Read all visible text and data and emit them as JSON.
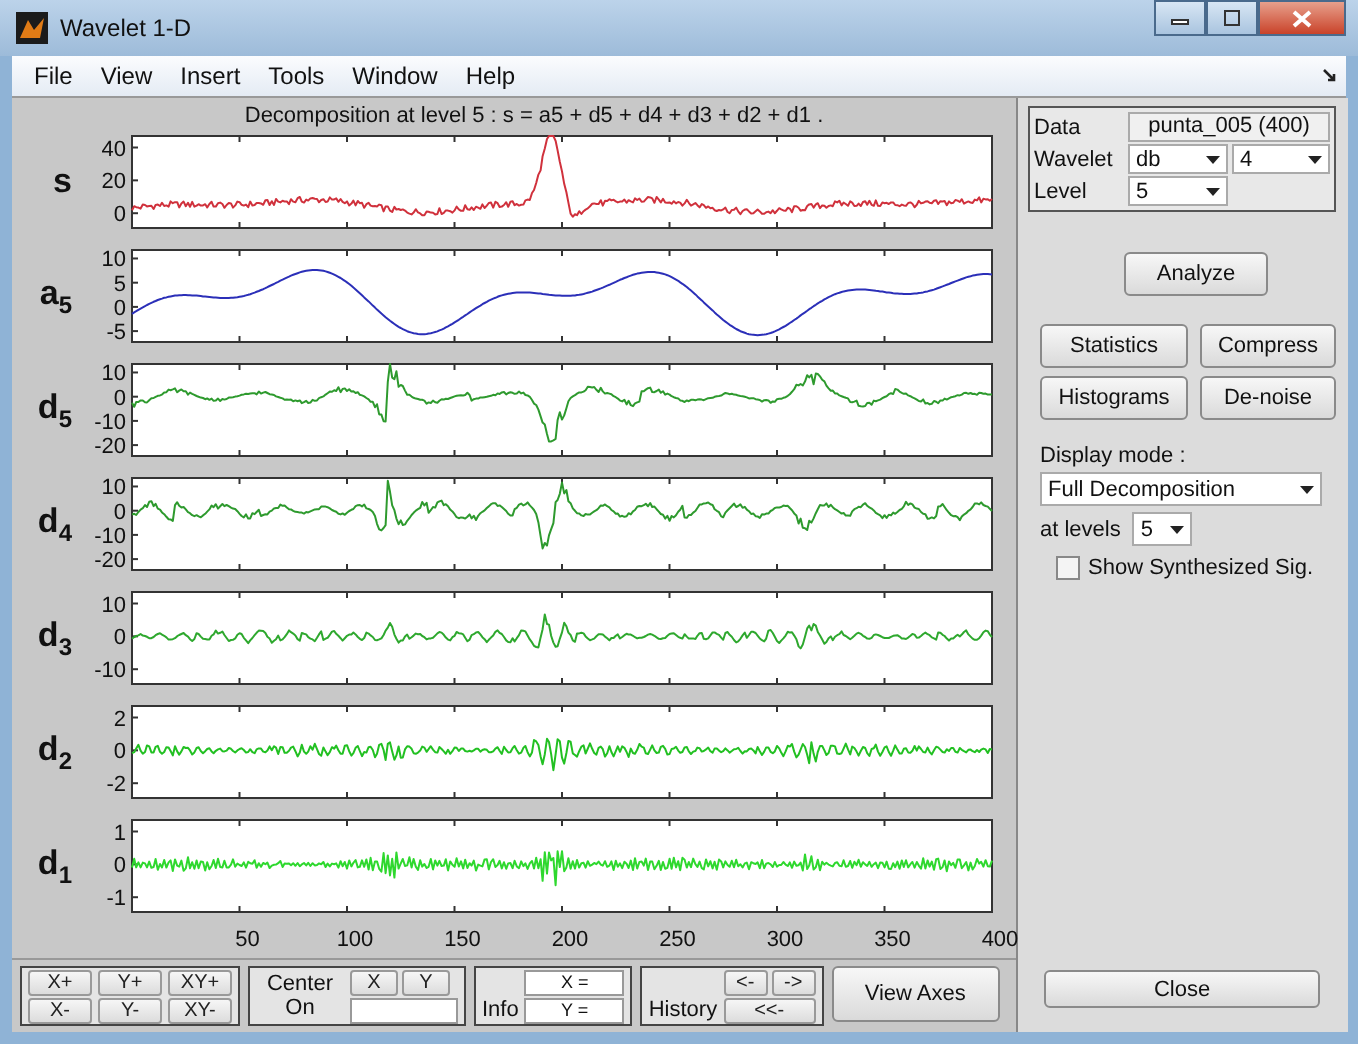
{
  "window": {
    "title": "Wavelet 1-D"
  },
  "menu": [
    "File",
    "View",
    "Insert",
    "Tools",
    "Window",
    "Help"
  ],
  "plot_title": "Decomposition at level 5 : s = a5 + d5 + d4 + d3 + d2 + d1 .",
  "plots": [
    {
      "label": "s",
      "kind": "signal",
      "color": "#d0313c",
      "yticks": [
        "40",
        "20",
        "0"
      ]
    },
    {
      "label": "a$_{5}$",
      "kind": "approximation",
      "color": "#2b2fb8",
      "yticks": [
        "10",
        "5",
        "0",
        "-5"
      ]
    },
    {
      "label": "d$_{5}$",
      "kind": "detail",
      "color": "#2e9a2e",
      "yticks": [
        "10",
        "0",
        "-10",
        "-20"
      ]
    },
    {
      "label": "d$_{4}$",
      "kind": "detail",
      "color": "#2e9a2e",
      "yticks": [
        "10",
        "0",
        "-10",
        "-20"
      ]
    },
    {
      "label": "d$_{3}$",
      "kind": "detail",
      "color": "#2ea82e",
      "yticks": [
        "10",
        "0",
        "-10"
      ]
    },
    {
      "label": "d$_{2}$",
      "kind": "detail",
      "color": "#22c022",
      "yticks": [
        "2",
        "0",
        "-2"
      ]
    },
    {
      "label": "d$_{1}$",
      "kind": "detail",
      "color": "#2ed82e",
      "yticks": [
        "1",
        "0",
        "-1"
      ]
    }
  ],
  "xticks": [
    "50",
    "100",
    "150",
    "200",
    "250",
    "300",
    "350",
    "400"
  ],
  "settings": {
    "data_label": "Data",
    "data_value": "punta_005  (400)",
    "wavelet_label": "Wavelet",
    "wavelet_family": "db",
    "wavelet_order": "4",
    "level_label": "Level",
    "level_value": "5"
  },
  "analyze": "Analyze",
  "tools": [
    "Statistics",
    "Compress",
    "Histograms",
    "De-noise"
  ],
  "display": {
    "label": "Display mode :",
    "mode": "Full Decomposition",
    "levels_label": "at levels",
    "levels_value": "5",
    "synth_label": "Show Synthesized Sig.",
    "synth_checked": false
  },
  "close": "Close",
  "zoom_buttons": [
    "X+",
    "Y+",
    "XY+",
    "X-",
    "Y-",
    "XY-"
  ],
  "center": {
    "label": "Center On",
    "x": "X",
    "y": "Y"
  },
  "info": {
    "label": "Info",
    "x": "X =",
    "y": "Y ="
  },
  "history": {
    "label": "History",
    "back": "<-",
    "forward": "->",
    "first": "<<-"
  },
  "view_axes": "View Axes"
}
